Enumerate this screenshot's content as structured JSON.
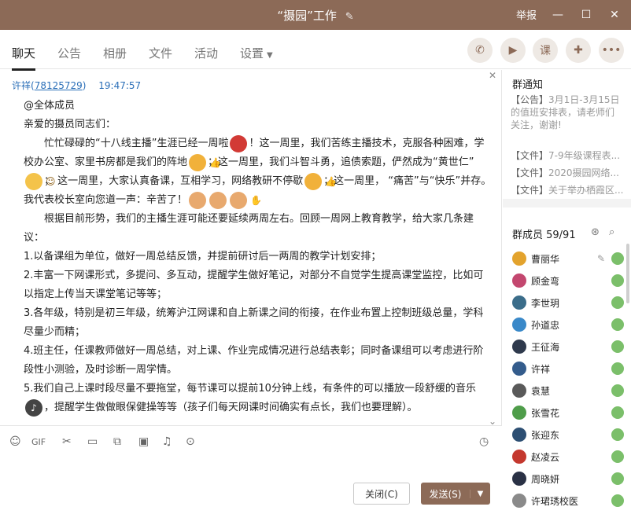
{
  "window": {
    "title": "“摄园”工作",
    "report_label": "举报"
  },
  "tabs": [
    {
      "label": "聊天"
    },
    {
      "label": "公告"
    },
    {
      "label": "相册"
    },
    {
      "label": "文件"
    },
    {
      "label": "活动"
    },
    {
      "label": "设置"
    }
  ],
  "toolbar_icons": [
    "phone-icon",
    "video-icon",
    "course-icon",
    "comment-icon",
    "more-icon"
  ],
  "toolbar": {
    "course_label": "课"
  },
  "message": {
    "sender_name": "许祥(",
    "sender_id": "78125729",
    "sender_suffix": ")",
    "time": "19:47:57",
    "lines": {
      "l1": "@全体成员",
      "l2": "亲爱的摄员同志们：",
      "p1a": "忙忙碌碌的“十八线主播”生涯已经一周啦",
      "p1b": "！这一周里，我们苦练主播技术，克服各种困难，学校办公室、家里书房都是我们的阵地",
      "p1c": "；这一周里，我们斗智斗勇，追债索题，俨然成为“黄世仁”",
      "p1d": "； 这一周里，大家认真备课，互相学习，网络教研不停歇",
      "p1e": "；这一周里， “痛苦”与“快乐”并存。我代表校长室向您道一声：辛苦了！",
      "p2": "根据目前形势，我们的主播生涯可能还要延续两周左右。回顾一周网上教育教学，给大家几条建议：",
      "i1": "1.以备课组为单位，做好一周总结反馈，并提前研讨后一两周的教学计划安排；",
      "i2": "2.丰富一下网课形式，多提问、多互动，提醒学生做好笔记，对部分不自觉学生提高课堂监控，比如可以指定上传当天课堂笔记等等；",
      "i3": "3.各年级，特别是初三年级，统筹沪江网课和自上新课之间的衔接，在作业布置上控制班级总量，学科尽量少而精；",
      "i4": "4.班主任，任课教师做好一周总结，对上课、作业完成情况进行总结表彰；同时备课组可以考虑进行阶段性小测验，及时诊断一周学情。",
      "i5a": "5.我们自己上课时段尽量不要拖堂，每节课可以提前10分钟上线，有条件的可以播放一段舒缓的音乐",
      "i5b": "，提醒学生做做眼保健操等等（孩子们每天网课时间确实有点长，我们也要理解）。"
    }
  },
  "input": {
    "close_label": "关闭(C)",
    "send_label": "发送(S)"
  },
  "notice": {
    "title": "群通知",
    "announcement_tag": "【公告】",
    "announcement_text": "3月1日-3月15日",
    "announcement_line2": "的值班安排表，请老师们",
    "announcement_line3": "关注，谢谢!",
    "files": [
      {
        "tag": "【文件】",
        "name": "7-9年级课程表..."
      },
      {
        "tag": "【文件】",
        "name": "2020摄园网络..."
      },
      {
        "tag": "【文件】",
        "name": "关于举办栖霞区..."
      }
    ]
  },
  "members": {
    "title": "群成员 59/91",
    "list": [
      {
        "name": "曹丽华",
        "color": "#e3a32d"
      },
      {
        "name": "顾金弯",
        "color": "#c3476f"
      },
      {
        "name": "李世玥",
        "color": "#3b6d8a"
      },
      {
        "name": "孙道忠",
        "color": "#3a89c9"
      },
      {
        "name": "王征海",
        "color": "#2f3a4d"
      },
      {
        "name": "许祥",
        "color": "#345c8c"
      },
      {
        "name": "袁慧",
        "color": "#5a5a5a"
      },
      {
        "name": "张雪花",
        "color": "#4f9d4a"
      },
      {
        "name": "张迎东",
        "color": "#2d4f73"
      },
      {
        "name": "赵凌云",
        "color": "#c4382e"
      },
      {
        "name": "周晓妍",
        "color": "#2a3145"
      },
      {
        "name": "许珺琇校医",
        "color": "#8a8a8a"
      }
    ]
  }
}
